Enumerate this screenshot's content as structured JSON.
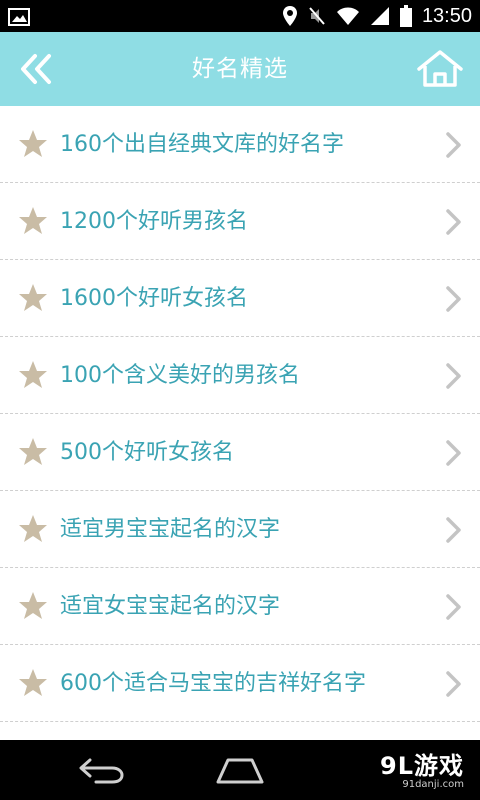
{
  "status_bar": {
    "time": "13:50",
    "icons": [
      "image-icon",
      "location-icon",
      "mute-icon",
      "wifi-icon",
      "signal-icon",
      "battery-icon"
    ]
  },
  "app_bar": {
    "title": "好名精选",
    "back_icon": "double-chevron-left-icon",
    "home_icon": "home-icon",
    "background_color": "#8fdde4"
  },
  "list": {
    "items": [
      {
        "label": "160个出自经典文库的好名字"
      },
      {
        "label": "1200个好听男孩名"
      },
      {
        "label": "1600个好听女孩名"
      },
      {
        "label": "100个含义美好的男孩名"
      },
      {
        "label": "500个好听女孩名"
      },
      {
        "label": "适宜男宝宝起名的汉字"
      },
      {
        "label": "适宜女宝宝起名的汉字"
      },
      {
        "label": "600个适合马宝宝的吉祥好名字"
      }
    ],
    "text_color": "#3aa3b3",
    "star_color": "#c9bca5"
  },
  "nav_bar": {
    "icons": [
      "back-arrow-icon",
      "home-outline-icon"
    ]
  },
  "watermark": {
    "logo": "9L游戏",
    "url": "91danji.com"
  }
}
